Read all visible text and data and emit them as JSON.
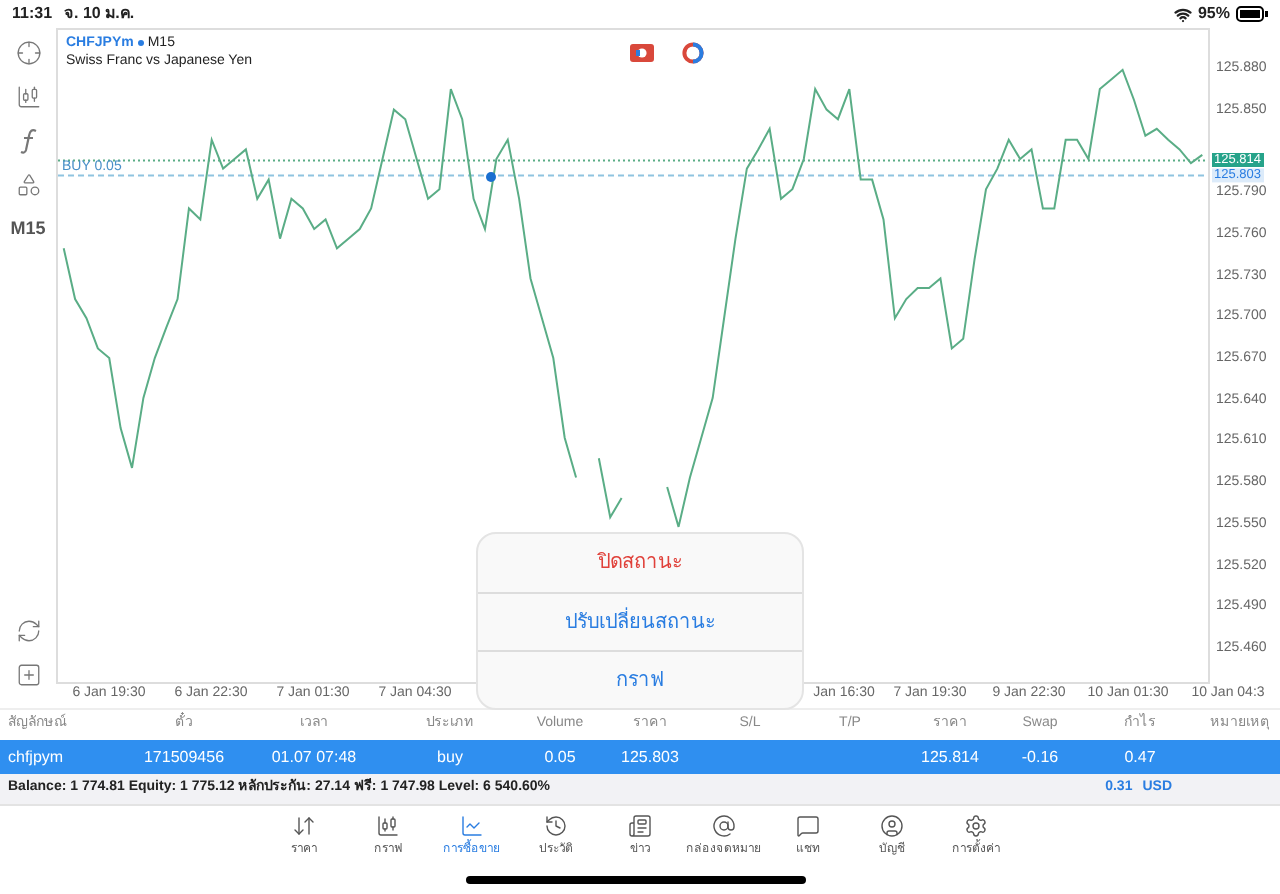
{
  "status_bar": {
    "time": "11:31",
    "date": "จ. 10 ม.ค.",
    "battery": "95%"
  },
  "left_toolbar": {
    "timeframe": "M15"
  },
  "chart": {
    "symbol": "CHFJPYm",
    "timeframe": "M15",
    "description": "Swiss Franc vs Japanese Yen",
    "order_line_label": "BUY 0.05",
    "time_labels": [
      "6 Jan 19:30",
      "6 Jan 22:30",
      "7 Jan 01:30",
      "7 Jan 04:30",
      "Jan 16:30",
      "7 Jan 19:30",
      "9 Jan 22:30",
      "10 Jan 01:30",
      "10 Jan 04:3"
    ],
    "chart_data": {
      "type": "line",
      "ylim": [
        125.434,
        125.909
      ],
      "yticks": [
        {
          "value": 125.88,
          "label": "125.880"
        },
        {
          "value": 125.85,
          "label": "125.850"
        },
        {
          "value": 125.79,
          "label": "125.790"
        },
        {
          "value": 125.76,
          "label": "125.760"
        },
        {
          "value": 125.73,
          "label": "125.730"
        },
        {
          "value": 125.7,
          "label": "125.700"
        },
        {
          "value": 125.67,
          "label": "125.670"
        },
        {
          "value": 125.64,
          "label": "125.640"
        },
        {
          "value": 125.61,
          "label": "125.610"
        },
        {
          "value": 125.58,
          "label": "125.580"
        },
        {
          "value": 125.55,
          "label": "125.550"
        },
        {
          "value": 125.52,
          "label": "125.520"
        },
        {
          "value": 125.49,
          "label": "125.490"
        },
        {
          "value": 125.46,
          "label": "125.460"
        }
      ],
      "ref_lines": [
        {
          "axis": "y",
          "value": 125.814,
          "label": "125.814",
          "color": "#5aad86"
        },
        {
          "axis": "y",
          "value": 125.803,
          "label": "125.803",
          "color": "#8fc4e0"
        }
      ],
      "series": [
        {
          "color": "#5aad86",
          "values": [
            125.75,
            125.713,
            125.699,
            125.677,
            125.67,
            125.619,
            125.59,
            125.641,
            125.67,
            125.692,
            125.713,
            125.779,
            125.771,
            125.829,
            125.808,
            125.815,
            125.822,
            125.786,
            125.8,
            125.757,
            125.786,
            125.779,
            125.764,
            125.771,
            125.75,
            125.757,
            125.764,
            125.779,
            125.815,
            125.851,
            125.844,
            125.815,
            125.786,
            125.793,
            125.866,
            125.844,
            125.786,
            125.764,
            125.815,
            125.829,
            125.786,
            125.728,
            125.699,
            125.67,
            125.612,
            125.583,
            null,
            125.597,
            125.554,
            125.568,
            null,
            null,
            null,
            125.576,
            125.547,
            125.583,
            125.612,
            125.641,
            125.699,
            125.757,
            125.808,
            125.822,
            125.837,
            125.786,
            125.793,
            125.815,
            125.866,
            125.851,
            125.844,
            125.866,
            125.8,
            125.8,
            125.771,
            125.699,
            125.713,
            125.721,
            125.721,
            125.728,
            125.677,
            125.684,
            125.742,
            125.793,
            125.808,
            125.829,
            125.815,
            125.822,
            125.779,
            125.779,
            125.829,
            125.829,
            125.815,
            125.866,
            125.873,
            125.88,
            125.858,
            125.832,
            125.837,
            125.829,
            125.822,
            125.812,
            125.818
          ]
        }
      ]
    }
  },
  "table": {
    "columns": [
      "สัญลักษณ์",
      "ตั๋ว",
      "เวลา",
      "ประเภท",
      "Volume",
      "ราคา",
      "S/L",
      "T/P",
      "ราคา",
      "Swap",
      "กำไร",
      "หมายเหตุ"
    ],
    "rows": [
      {
        "selected": true,
        "cells": [
          "chfjpym",
          "171509456",
          "01.07 07:48",
          "buy",
          "0.05",
          "125.803",
          null,
          null,
          "125.814",
          "-0.16",
          "0.47",
          null
        ]
      }
    ]
  },
  "account_summary": {
    "text": "Balance: 1 774.81 Equity: 1 775.12 หลักประกัน: 27.14 ฟรี: 1 747.98 Level: 6 540.60%",
    "profit": "0.31",
    "currency": "USD"
  },
  "popup": {
    "items": [
      {
        "label": "ปิดสถานะ",
        "kind": "destructive"
      },
      {
        "label": "ปรับเปลี่ยนสถานะ",
        "kind": "normal"
      },
      {
        "label": "กราฟ",
        "kind": "normal"
      }
    ]
  },
  "tab_bar": [
    {
      "label": "ราคา",
      "selected": false
    },
    {
      "label": "กราฟ",
      "selected": false
    },
    {
      "label": "การซื้อขาย",
      "selected": true
    },
    {
      "label": "ประวัติ",
      "selected": false
    },
    {
      "label": "ข่าว",
      "selected": false
    },
    {
      "label": "กล่องจดหมาย",
      "selected": false
    },
    {
      "label": "แชท",
      "selected": false
    },
    {
      "label": "บัญชี",
      "selected": false
    },
    {
      "label": "การตั้งค่า",
      "selected": false
    }
  ]
}
